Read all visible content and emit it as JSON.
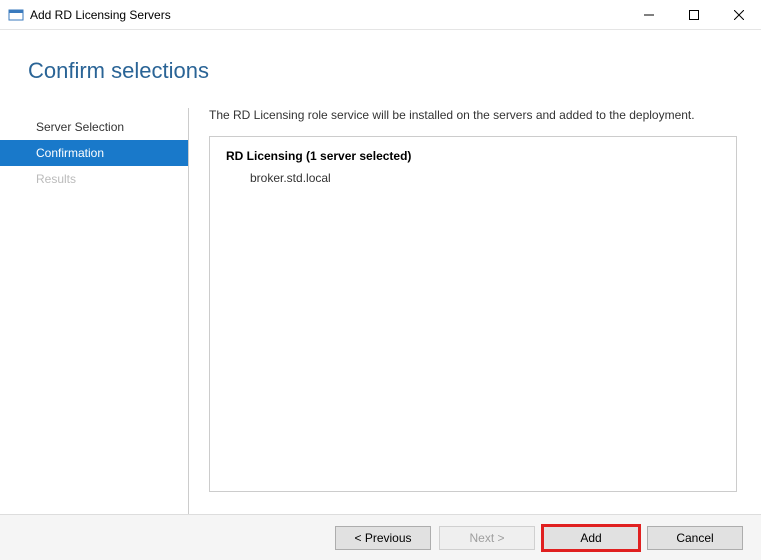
{
  "titlebar": {
    "title": "Add RD Licensing Servers"
  },
  "page": {
    "heading": "Confirm selections"
  },
  "sidebar": {
    "items": [
      {
        "label": "Server Selection",
        "state": "normal"
      },
      {
        "label": "Confirmation",
        "state": "selected"
      },
      {
        "label": "Results",
        "state": "disabled"
      }
    ]
  },
  "main": {
    "description": "The RD Licensing role service will be installed on the servers and added to the deployment.",
    "group_title": "RD Licensing  (1 server selected)",
    "servers": [
      "broker.std.local"
    ]
  },
  "buttons": {
    "previous": "< Previous",
    "next": "Next >",
    "add": "Add",
    "cancel": "Cancel"
  }
}
